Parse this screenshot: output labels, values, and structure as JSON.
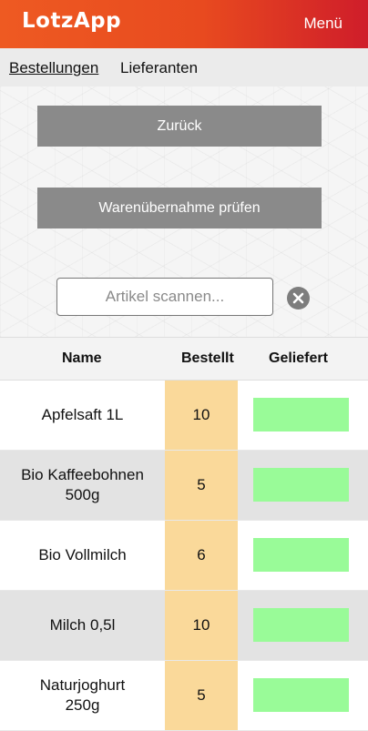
{
  "app": {
    "title": "LotzApp",
    "menu_label": "Menü"
  },
  "nav": {
    "tabs": [
      {
        "label": "Bestellungen"
      },
      {
        "label": "Lieferanten"
      }
    ]
  },
  "actions": {
    "back_label": "Zurück",
    "check_label": "Warenübernahme prüfen"
  },
  "search": {
    "placeholder": "Artikel scannen...",
    "value": ""
  },
  "colors": {
    "header_start": "#ee5a22",
    "header_end": "#cf1d2a",
    "ordered_bg": "#fad99a",
    "delivered_bg": "#99fb98"
  },
  "table": {
    "headers": {
      "name": "Name",
      "ordered": "Bestellt",
      "delivered": "Geliefert"
    },
    "rows": [
      {
        "name": "Apfelsaft 1L",
        "ordered": "10",
        "delivered": ""
      },
      {
        "name": "Bio Kaffeebohnen 500g",
        "ordered": "5",
        "delivered": ""
      },
      {
        "name": "Bio Vollmilch",
        "ordered": "6",
        "delivered": ""
      },
      {
        "name": "Milch 0,5l",
        "ordered": "10",
        "delivered": ""
      },
      {
        "name": "Naturjoghurt 250g",
        "ordered": "5",
        "delivered": ""
      }
    ]
  }
}
